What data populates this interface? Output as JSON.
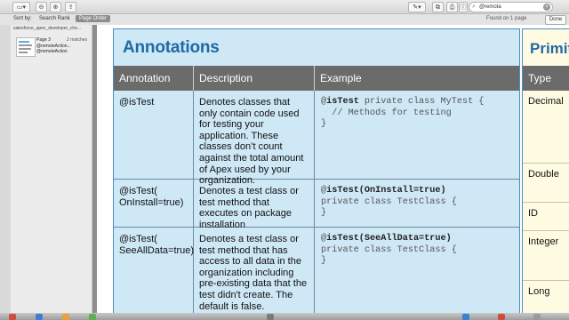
{
  "toolbar": {
    "buttons": [
      "▭▾",
      "⊖",
      "⊕",
      "⇪",
      "✎▾",
      "⧉",
      "⎙",
      "ⓘ"
    ],
    "search_value": "@remota",
    "search_icon": "magnifier-icon",
    "clear_icon": "clear-icon"
  },
  "sortbar": {
    "label": "Sort by:",
    "option_search_rank": "Search Rank",
    "option_page_order": "Page Order",
    "found_text": "Found on 1 page",
    "done_label": "Done"
  },
  "sidebar": {
    "path": "salesforce_apex_developer_che...",
    "result": {
      "page": "Page 3",
      "matches": "2 matches",
      "match_1": "@remoteAction...",
      "match_2": "@remoteAction"
    }
  },
  "slide": {
    "title": "Annotations",
    "headers": [
      "Annotation",
      "Description",
      "Example"
    ],
    "rows": [
      {
        "annotation": "@isTest",
        "description": "Denotes classes that only contain code used for testing your application. These classes don’t count against the total amount of Apex used by your organization.",
        "example": {
          "line1_prefix": "@",
          "line1_bold": "isTest",
          "line1_rest": " private class MyTest {",
          "line2": "  // Methods for testing",
          "line3": "}"
        }
      },
      {
        "annotation": "@isTest( OnInstall=true)",
        "description": "Denotes a test class or test method that executes on package installation",
        "example": {
          "line1_prefix": "@",
          "line1_bold": "isTest(OnInstall=true)",
          "line1_rest": "",
          "line2": "private class TestClass {",
          "line3": "}"
        }
      },
      {
        "annotation": "@isTest( SeeAllData=true)",
        "description": "Denotes a test class or test method that has access to all data in the organization including pre-existing data that the test didn't create. The default is false.",
        "example": {
          "line1_prefix": "@",
          "line1_bold": "isTest(SeeAllData=true)",
          "line1_rest": "",
          "line2": "private class TestClass {",
          "line3": "}"
        }
      }
    ]
  },
  "slide2": {
    "title": "Primit",
    "header": "Type",
    "cells": [
      "Decimal",
      "Double",
      "ID",
      "Integer",
      "Long"
    ]
  }
}
